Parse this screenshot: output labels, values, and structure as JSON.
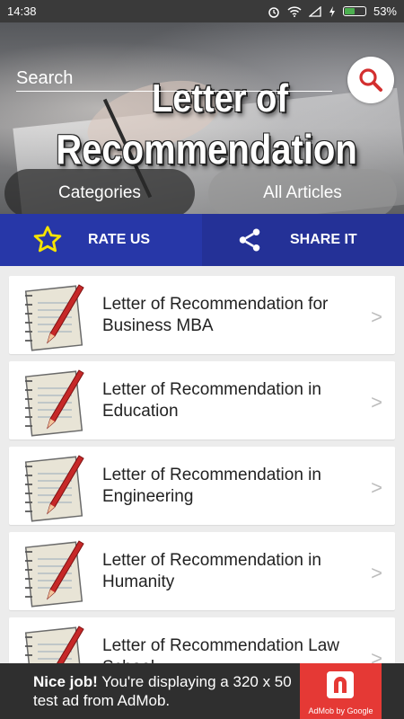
{
  "status_bar": {
    "time": "14:38",
    "battery": "53%",
    "battery_level": 0.53
  },
  "header": {
    "search_placeholder": "Search",
    "title_line1": "Letter of",
    "title_line2": "Recommendation",
    "categories_label": "Categories",
    "all_articles_label": "All Articles"
  },
  "actions": {
    "rate_label": "RATE US",
    "share_label": "SHARE IT"
  },
  "articles": [
    {
      "title": "Letter of Recommendation for Business MBA"
    },
    {
      "title": "Letter of Recommendation in Education"
    },
    {
      "title": "Letter of Recommendation in Engineering"
    },
    {
      "title": "Letter of Recommendation in Humanity"
    },
    {
      "title": "Letter of Recommendation Law School"
    }
  ],
  "chevron": ">",
  "ad": {
    "headline": "Nice job!",
    "body": " You're displaying a 320 x 50 test ad from AdMob.",
    "badge": "AdMob by Google"
  },
  "colors": {
    "rate_bg": "#2737a8",
    "share_bg": "#243197",
    "star": "#f5e400",
    "ad_red": "#e53935"
  }
}
